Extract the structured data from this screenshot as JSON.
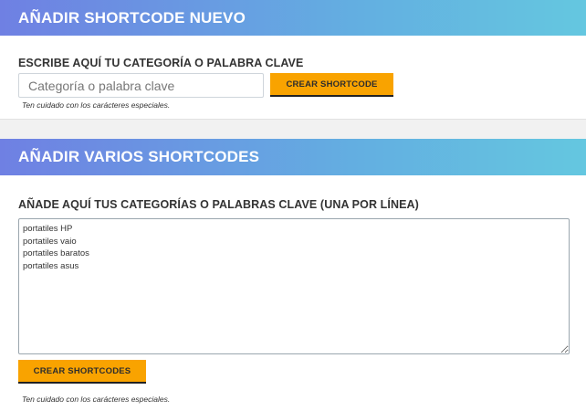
{
  "single": {
    "header_title": "AÑADIR SHORTCODE NUEVO",
    "field_label": "ESCRIBE AQUÍ TU CATEGORÍA O PALABRA CLAVE",
    "input_placeholder": "Categoría o palabra clave",
    "input_value": "",
    "button_label": "CREAR SHORTCODE",
    "hint": "Ten cuidado con los carácteres especiales."
  },
  "multiple": {
    "header_title": "AÑADIR VARIOS SHORTCODES",
    "field_label": "AÑADE AQUÍ TUS CATEGORÍAS O PALABRAS CLAVE (UNA POR LÍNEA)",
    "textarea_lines": [
      "portatiles HP",
      "portatiles vaio",
      "portatiles baratos",
      "portatiles asus"
    ],
    "button_label": "CREAR SHORTCODES",
    "hint": "Ten cuidado con los carácteres especiales."
  },
  "colors": {
    "header_gradient_start": "#6f80e3",
    "header_gradient_end": "#64c7e0",
    "button_accent": "#f9a300"
  }
}
